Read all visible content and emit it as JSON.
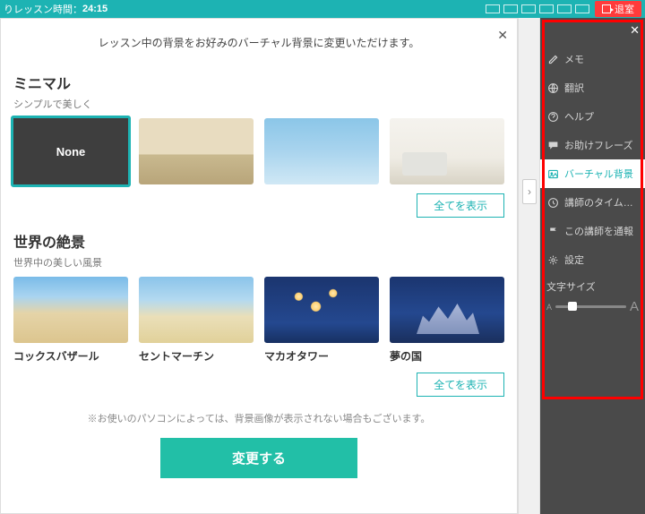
{
  "topbar": {
    "timer_label": "りレッスン時間：",
    "timer_value": "24:15",
    "exit_label": "退室"
  },
  "modal": {
    "header": "レッスン中の背景をお好みのバーチャル背景に変更いただけます。",
    "show_all": "全てを表示",
    "disclaimer": "※お使いのパソコンによっては、背景画像が表示されない場合もございます。",
    "apply": "変更する",
    "cat1": {
      "title": "ミニマル",
      "sub": "シンプルで美しく",
      "items": [
        {
          "label": "None"
        },
        {
          "label": ""
        },
        {
          "label": ""
        },
        {
          "label": ""
        }
      ]
    },
    "cat2": {
      "title": "世界の絶景",
      "sub": "世界中の美しい風景",
      "items": [
        {
          "label": "コックスバザール"
        },
        {
          "label": "セントマーチン"
        },
        {
          "label": "マカオタワー"
        },
        {
          "label": "夢の国"
        }
      ]
    }
  },
  "side": {
    "items": [
      {
        "icon": "edit",
        "label": "メモ"
      },
      {
        "icon": "globe",
        "label": "翻訳"
      },
      {
        "icon": "help",
        "label": "ヘルプ"
      },
      {
        "icon": "chat",
        "label": "お助けフレーズ"
      },
      {
        "icon": "image",
        "label": "バーチャル背景"
      },
      {
        "icon": "clock",
        "label": "講師のタイムゾーン"
      },
      {
        "icon": "flag",
        "label": "この講師を通報"
      },
      {
        "icon": "gear",
        "label": "設定"
      }
    ],
    "font_size_label": "文字サイズ"
  }
}
